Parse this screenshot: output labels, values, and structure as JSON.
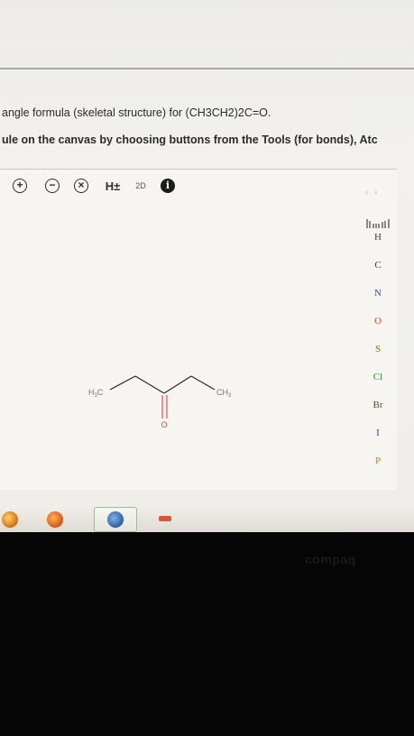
{
  "question": {
    "line1": "angle formula (skeletal structure) for (CH3CH2)2C=O.",
    "line2": "ule on the canvas by choosing buttons from the Tools (for bonds), Atc"
  },
  "toolbar": {
    "zoom_in_symbol": "+",
    "zoom_out_symbol": "−",
    "clear_symbol": "×",
    "hydrogens_label": "H±",
    "view_2d_label": "2D",
    "info_label": "i",
    "nav_arrows": "‹ ›"
  },
  "molecule": {
    "left_label_main": "H",
    "left_label_sub": "3",
    "left_label_end": "C",
    "right_label_main": "CH",
    "right_label_sub": "3",
    "oxygen_label": "O",
    "bond_color": "#2a2a2a",
    "oxygen_color": "#e44a2c",
    "double_bond_color": "#d9534f"
  },
  "palette": {
    "elements": [
      {
        "symbol": "H",
        "color": "#3a3a3a"
      },
      {
        "symbol": "C",
        "color": "#3a3a3a"
      },
      {
        "symbol": "N",
        "color": "#2b4eb8"
      },
      {
        "symbol": "O",
        "color": "#e2401f"
      },
      {
        "symbol": "S",
        "color": "#8a6a1c"
      },
      {
        "symbol": "Cl",
        "color": "#2f8a2f"
      },
      {
        "symbol": "Br",
        "color": "#6b3b2a"
      },
      {
        "symbol": "I",
        "color": "#6a2a8a"
      },
      {
        "symbol": "P",
        "color": "#c07a2a"
      }
    ]
  },
  "taskbar": {
    "icons": [
      "windows-orb-icon",
      "media-player-icon",
      "active-app-icon",
      "flag-app-icon"
    ]
  },
  "bezel": {
    "brand_text": "compaq"
  }
}
